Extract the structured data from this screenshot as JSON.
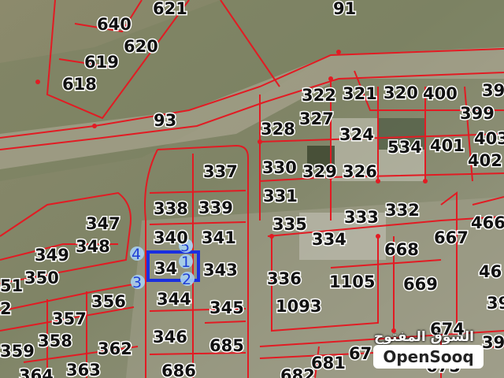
{
  "map": {
    "parcels": [
      "621",
      "640",
      "620",
      "619",
      "618",
      "91",
      "93",
      "322",
      "321",
      "320",
      "400",
      "399",
      "39",
      "328",
      "327",
      "324",
      "534",
      "401",
      "403",
      "330",
      "329",
      "326",
      "402",
      "337",
      "331",
      "338",
      "339",
      "333",
      "332",
      "466",
      "347",
      "348",
      "349",
      "350",
      "51",
      "340",
      "341",
      "343",
      "335",
      "334",
      "668",
      "667",
      "336",
      "1105",
      "669",
      "344",
      "356",
      "345",
      "1093",
      "2",
      "357",
      "358",
      "362",
      "346",
      "685",
      "359",
      "686",
      "363",
      "364",
      "681",
      "682",
      "67",
      "675",
      "674",
      "46",
      "39b",
      "34"
    ],
    "labels": {
      "p621": "621",
      "p640": "640",
      "p620": "620",
      "p619": "619",
      "p618": "618",
      "p91": "91",
      "p93": "93",
      "p322": "322",
      "p321": "321",
      "p320": "320",
      "p400": "400",
      "p39": "39",
      "p328": "328",
      "p327": "327",
      "p324": "324",
      "p399": "399",
      "p534": "534",
      "p401": "401",
      "p403": "403",
      "p330": "330",
      "p329": "329",
      "p326": "326",
      "p402": "402",
      "p337": "337",
      "p331": "331",
      "p338": "338",
      "p339": "339",
      "p333": "333",
      "p332": "332",
      "p466": "466",
      "p347": "347",
      "p348": "348",
      "p349": "349",
      "p350": "350",
      "p51": "51",
      "p340": "340",
      "p341": "341",
      "p343": "343",
      "p34": "34",
      "p335": "335",
      "p334": "334",
      "p668": "668",
      "p667": "667",
      "p336": "336",
      "p1105": "1105",
      "p669": "669",
      "p46": "46",
      "p344": "344",
      "p356": "356",
      "p345": "345",
      "p1093": "1093",
      "p2": "2",
      "p357": "357",
      "p358": "358",
      "p362": "362",
      "p346": "346",
      "p685": "685",
      "p359": "359",
      "p686": "686",
      "p363": "363",
      "p364": "364",
      "p681": "681",
      "p682": "682",
      "p67": "67",
      "p675": "675",
      "p674": "674",
      "p39b": "39",
      "p39c": "39"
    },
    "vertices": {
      "v1": "1",
      "v2": "2",
      "v3": "3",
      "v4": "4",
      "v5": "5"
    },
    "colors": {
      "boundary": "#e21b23",
      "selected": "#1a2fe0",
      "vertex_fill": "#a9d2f2"
    }
  },
  "watermark": {
    "arabic": "السوق المفتوح",
    "brand": "OpenSooq"
  }
}
